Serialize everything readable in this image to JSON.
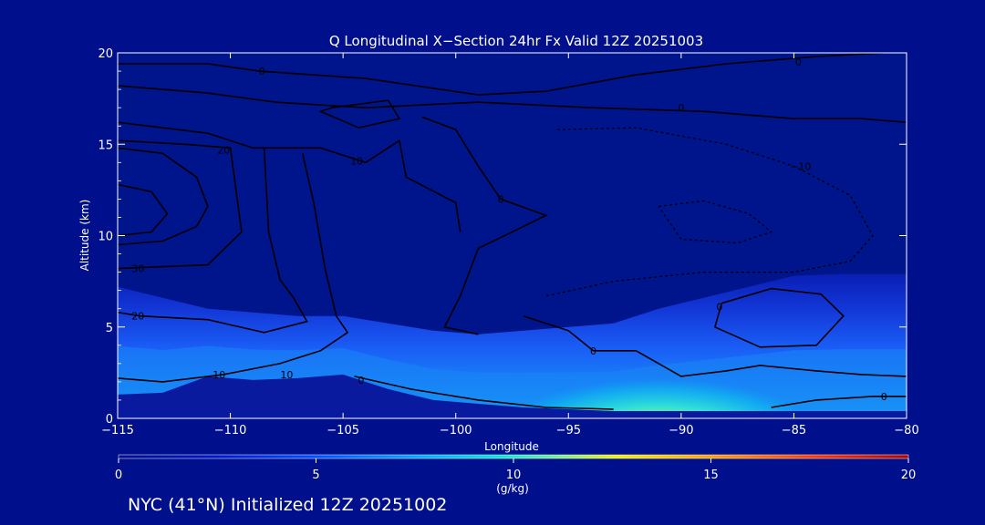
{
  "chart_data": {
    "type": "heatmap",
    "title": "Q Longitudinal X−Section 24hr  Fx Valid 12Z 20251003",
    "xlabel": "Longitude",
    "ylabel": "Altitude (km)",
    "xlim": [
      -115,
      -80
    ],
    "ylim": [
      0,
      20
    ],
    "x_ticks": [
      -115,
      -110,
      -105,
      -100,
      -95,
      -90,
      -85,
      -80
    ],
    "x_tick_labels": [
      "−115",
      "−110",
      "−105",
      "−100",
      "−95",
      "−90",
      "−85",
      "−80"
    ],
    "y_ticks": [
      0,
      5,
      10,
      15,
      20
    ],
    "y_tick_labels": [
      "0",
      "5",
      "10",
      "15",
      "20"
    ],
    "colorbar": {
      "label": "(g/kg)",
      "range": [
        0,
        20
      ],
      "ticks": [
        0,
        5,
        10,
        15,
        20
      ],
      "tick_labels": [
        "0",
        "5",
        "10",
        "15",
        "20"
      ]
    },
    "moisture_field": {
      "description_units": "g/kg",
      "x": [
        -115,
        -113,
        -111,
        -109,
        -107,
        -105,
        -103,
        -101,
        -99,
        -97,
        -95,
        -93,
        -91,
        -89,
        -87,
        -85,
        -83,
        -81,
        -80
      ],
      "surface_height_km": [
        1.3,
        1.4,
        2.3,
        2.1,
        2.2,
        2.4,
        1.6,
        1.0,
        0.8,
        0.6,
        0.5,
        0.4,
        0.4,
        0.4,
        0.4,
        0.4,
        0.4,
        0.4,
        0.4
      ],
      "moist_layer_top_km": [
        7.2,
        6.6,
        6.0,
        5.8,
        5.6,
        5.6,
        5.2,
        4.8,
        4.6,
        4.8,
        5.0,
        5.2,
        6.0,
        6.6,
        7.2,
        7.8,
        7.9,
        7.9,
        7.9
      ],
      "surface_q_gkg": [
        4.5,
        5.0,
        4.0,
        4.0,
        3.5,
        3.5,
        5.0,
        6.5,
        8.0,
        9.5,
        10.5,
        11.5,
        12.5,
        12.5,
        11.5,
        8.0,
        7.0,
        6.0,
        5.5
      ]
    },
    "contour_labels": [
      {
        "text": "0",
        "lon": -108.6,
        "alt": 19.0
      },
      {
        "text": "0",
        "lon": -84.8,
        "alt": 19.5
      },
      {
        "text": "0",
        "lon": -90.0,
        "alt": 17.0
      },
      {
        "text": "20",
        "lon": -110.3,
        "alt": 14.7
      },
      {
        "text": "10",
        "lon": -104.4,
        "alt": 14.1
      },
      {
        "text": "0",
        "lon": -98.0,
        "alt": 12.0
      },
      {
        "text": "−10",
        "lon": -84.7,
        "alt": 13.8
      },
      {
        "text": "30",
        "lon": -114.1,
        "alt": 8.2
      },
      {
        "text": "20",
        "lon": -114.1,
        "alt": 5.6
      },
      {
        "text": "0",
        "lon": -93.9,
        "alt": 3.7
      },
      {
        "text": "0",
        "lon": -88.3,
        "alt": 6.1
      },
      {
        "text": "10",
        "lon": -110.5,
        "alt": 2.4
      },
      {
        "text": "10",
        "lon": -107.5,
        "alt": 2.4
      },
      {
        "text": "0",
        "lon": -104.2,
        "alt": 2.1
      },
      {
        "text": "0",
        "lon": -81.0,
        "alt": 1.2
      }
    ]
  },
  "footer": {
    "caption": "NYC (41°N) Initialized 12Z 20251002"
  },
  "colors": {
    "background": "#000f8c",
    "low_q": "#00148c",
    "mid_q": "#1f5cff",
    "high_q": "#ffe600"
  }
}
